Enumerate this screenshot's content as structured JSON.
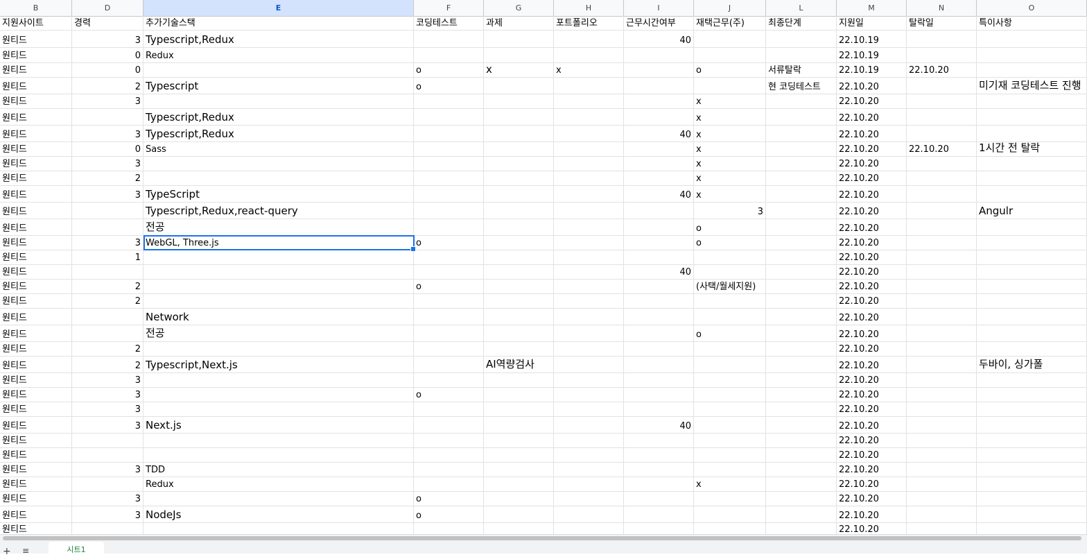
{
  "columns": [
    "B",
    "D",
    "E",
    "F",
    "G",
    "H",
    "I",
    "J",
    "L",
    "M",
    "N",
    "O"
  ],
  "selected_column": "E",
  "header": [
    "지원사이트",
    "경력",
    "추가기술스택",
    "코딩테스트",
    "과제",
    "포트폴리오",
    "근무시간여부",
    "재택근무(주)",
    "최종단계",
    "지원일",
    "탈락일",
    "특이사항"
  ],
  "rows": [
    [
      "원티드",
      "3",
      "Typescript,Redux",
      "",
      "",
      "",
      "40",
      "",
      "",
      "22.10.19",
      "",
      ""
    ],
    [
      "원티드",
      "0",
      "Redux",
      "",
      "",
      "",
      "",
      "",
      "",
      "22.10.19",
      "",
      ""
    ],
    [
      "원티드",
      "0",
      "",
      "o",
      "x",
      "x",
      "",
      "o",
      "서류탈락",
      "22.10.19",
      "22.10.20",
      ""
    ],
    [
      "원티드",
      "2",
      "Typescript",
      "o",
      "",
      "",
      "",
      "",
      "현 코딩테스트",
      "22.10.20",
      "",
      "미기재 코딩테스트  진행"
    ],
    [
      "원티드",
      "3",
      "",
      "",
      "",
      "",
      "",
      "x",
      "",
      "22.10.20",
      "",
      ""
    ],
    [
      "원티드",
      "",
      "Typescript,Redux",
      "",
      "",
      "",
      "",
      "x",
      "",
      "22.10.20",
      "",
      ""
    ],
    [
      "원티드",
      "3",
      "Typescript,Redux",
      "",
      "",
      "",
      "40",
      "x",
      "",
      "22.10.20",
      "",
      ""
    ],
    [
      "원티드",
      "0",
      "Sass",
      "",
      "",
      "",
      "",
      "x",
      "",
      "22.10.20",
      "22.10.20",
      "1시간 전 탈락"
    ],
    [
      "원티드",
      "3",
      "",
      "",
      "",
      "",
      "",
      "x",
      "",
      "22.10.20",
      "",
      ""
    ],
    [
      "원티드",
      "2",
      "",
      "",
      "",
      "",
      "",
      "x",
      "",
      "22.10.20",
      "",
      ""
    ],
    [
      "원티드",
      "3",
      "TypeScript",
      "",
      "",
      "",
      "40",
      "x",
      "",
      "22.10.20",
      "",
      ""
    ],
    [
      "원티드",
      "",
      "Typescript,Redux,react-query",
      "",
      "",
      "",
      "",
      "3",
      "",
      "22.10.20",
      "",
      "Angulr"
    ],
    [
      "원티드",
      "",
      "전공",
      "",
      "",
      "",
      "",
      "o",
      "",
      "22.10.20",
      "",
      ""
    ],
    [
      "원티드",
      "3",
      "WebGL, Three.js",
      "o",
      "",
      "",
      "",
      "o",
      "",
      "22.10.20",
      "",
      ""
    ],
    [
      "원티드",
      "1",
      "",
      "",
      "",
      "",
      "",
      "",
      "",
      "22.10.20",
      "",
      ""
    ],
    [
      "원티드",
      "",
      "",
      "",
      "",
      "",
      "40",
      "",
      "",
      "22.10.20",
      "",
      ""
    ],
    [
      "원티드",
      "2",
      "",
      "o",
      "",
      "",
      "",
      "(사택/월세지원)",
      "",
      "22.10.20",
      "",
      ""
    ],
    [
      "원티드",
      "2",
      "",
      "",
      "",
      "",
      "",
      "",
      "",
      "22.10.20",
      "",
      ""
    ],
    [
      "원티드",
      "",
      "Network",
      "",
      "",
      "",
      "",
      "",
      "",
      "22.10.20",
      "",
      ""
    ],
    [
      "원티드",
      "",
      "전공",
      "",
      "",
      "",
      "",
      "o",
      "",
      "22.10.20",
      "",
      ""
    ],
    [
      "원티드",
      "2",
      "",
      "",
      "",
      "",
      "",
      "",
      "",
      "22.10.20",
      "",
      ""
    ],
    [
      "원티드",
      "2",
      "Typescript,Next.js",
      "",
      "AI역량검사",
      "",
      "",
      "",
      "",
      "22.10.20",
      "",
      "두바이, 싱가폴"
    ],
    [
      "원티드",
      "3",
      "",
      "",
      "",
      "",
      "",
      "",
      "",
      "22.10.20",
      "",
      ""
    ],
    [
      "원티드",
      "3",
      "",
      "o",
      "",
      "",
      "",
      "",
      "",
      "22.10.20",
      "",
      ""
    ],
    [
      "원티드",
      "3",
      "",
      "",
      "",
      "",
      "",
      "",
      "",
      "22.10.20",
      "",
      ""
    ],
    [
      "원티드",
      "3",
      "Next.js",
      "",
      "",
      "",
      "40",
      "",
      "",
      "22.10.20",
      "",
      ""
    ],
    [
      "원티드",
      "",
      "",
      "",
      "",
      "",
      "",
      "",
      "",
      "22.10.20",
      "",
      ""
    ],
    [
      "원티드",
      "",
      "",
      "",
      "",
      "",
      "",
      "",
      "",
      "22.10.20",
      "",
      ""
    ],
    [
      "원티드",
      "3",
      "TDD",
      "",
      "",
      "",
      "",
      "",
      "",
      "22.10.20",
      "",
      ""
    ],
    [
      "원티드",
      "",
      "Redux",
      "",
      "",
      "",
      "",
      "x",
      "",
      "22.10.20",
      "",
      ""
    ],
    [
      "원티드",
      "3",
      "",
      "o",
      "",
      "",
      "",
      "",
      "",
      "22.10.20",
      "",
      ""
    ],
    [
      "원티드",
      "3",
      "NodeJs",
      "o",
      "",
      "",
      "",
      "",
      "",
      "22.10.20",
      "",
      ""
    ],
    [
      "원티드",
      "",
      "",
      "",
      "",
      "",
      "",
      "",
      "",
      "22.10.20",
      "",
      ""
    ]
  ],
  "sheet_tab_label": "시트1",
  "tab_icons": [
    "plus-icon",
    "list-icon"
  ]
}
